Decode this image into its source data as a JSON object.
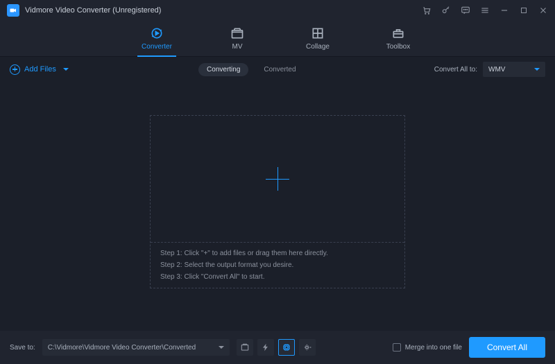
{
  "title": "Vidmore Video Converter (Unregistered)",
  "tabs": [
    {
      "label": "Converter"
    },
    {
      "label": "MV"
    },
    {
      "label": "Collage"
    },
    {
      "label": "Toolbox"
    }
  ],
  "subbar": {
    "add_files": "Add Files",
    "seg_converting": "Converting",
    "seg_converted": "Converted",
    "convert_all_to": "Convert All to:",
    "format_selected": "WMV"
  },
  "dropzone": {
    "step1": "Step 1: Click \"+\" to add files or drag them here directly.",
    "step2": "Step 2: Select the output format you desire.",
    "step3": "Step 3: Click \"Convert All\" to start."
  },
  "footer": {
    "save_to_label": "Save to:",
    "save_to_path": "C:\\Vidmore\\Vidmore Video Converter\\Converted",
    "merge_label": "Merge into one file",
    "convert_all": "Convert All"
  }
}
